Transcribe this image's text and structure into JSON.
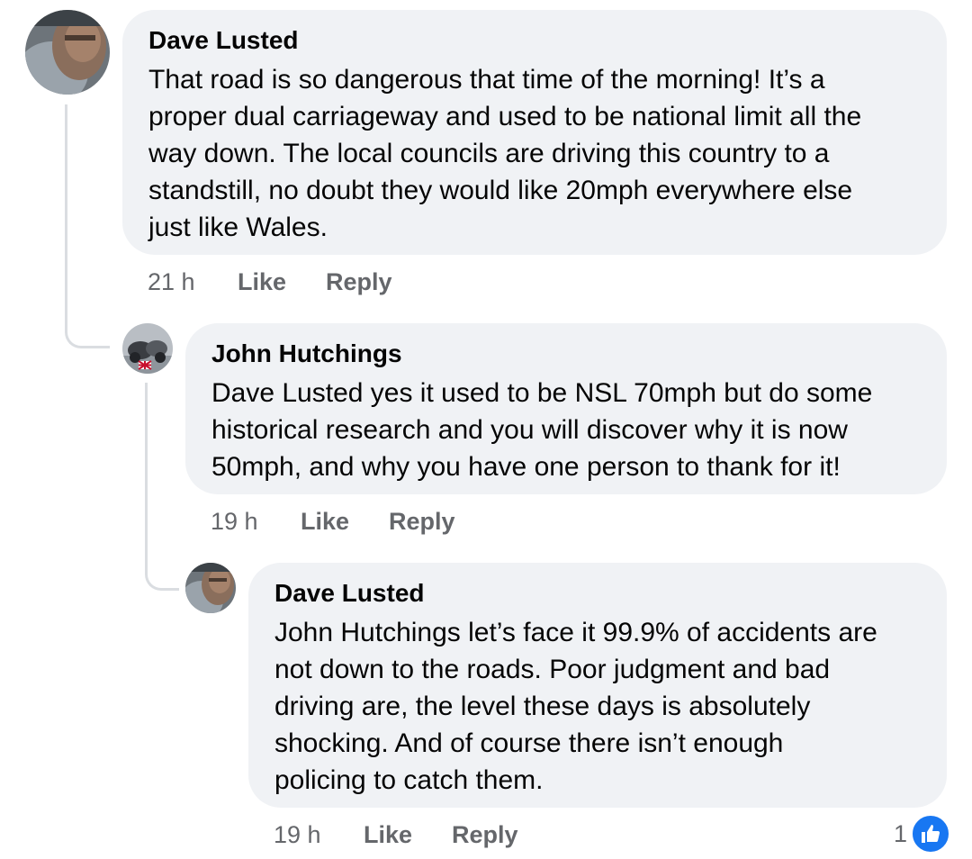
{
  "comments": [
    {
      "author": "Dave Lusted",
      "lines": [
        "That road is so dangerous that time of the morning!  It’s a",
        "proper dual carriageway and used to be national limit all the",
        "way down. The local councils are driving this country to a",
        "standstill, no doubt they would like 20mph everywhere else",
        "just like Wales."
      ],
      "time": "21 h",
      "like_label": "Like",
      "reply_label": "Reply"
    },
    {
      "author": "John Hutchings",
      "lines": [
        "Dave Lusted yes it used to be NSL 70mph  but do some",
        "historical research and you will discover why it is now",
        "50mph, and why you have one person to thank for it!"
      ],
      "time": "19 h",
      "like_label": "Like",
      "reply_label": "Reply"
    },
    {
      "author": "Dave Lusted",
      "lines": [
        "John Hutchings let’s face it 99.9% of accidents are",
        "not down to the roads. Poor judgment and bad",
        "driving are, the level these days is absolutely",
        "shocking. And of course there isn’t enough",
        "policing to catch them."
      ],
      "time": "19 h",
      "like_label": "Like",
      "reply_label": "Reply",
      "reaction_count": "1",
      "reaction_icon": "thumbs-up-icon"
    }
  ],
  "colors": {
    "bubble": "#f0f2f5",
    "meta_text": "#65676b",
    "like_blue": "#1877f2",
    "thread_line": "#dadde1"
  }
}
